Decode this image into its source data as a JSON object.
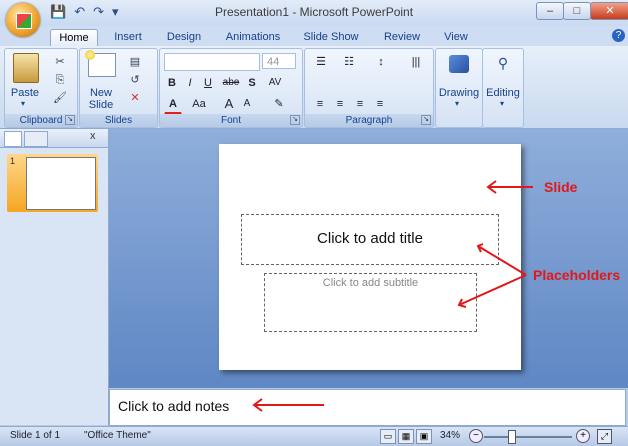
{
  "window": {
    "title": "Presentation1 - Microsoft PowerPoint",
    "minimize_label": "–",
    "maximize_label": "□",
    "close_label": "✕"
  },
  "qat": {
    "save_icon": "💾",
    "undo_icon": "↶",
    "redo_icon": "↷",
    "customize_icon": "▾"
  },
  "tabs": [
    "Home",
    "Insert",
    "Design",
    "Animations",
    "Slide Show",
    "Review",
    "View"
  ],
  "help_icon": "?",
  "ribbon": {
    "clipboard": {
      "label": "Clipboard",
      "paste": "Paste",
      "cut_icon": "✂",
      "copy_icon": "⎘",
      "painter_icon": "🖌"
    },
    "slides": {
      "label": "Slides",
      "new_slide": "New Slide",
      "layout_icon": "▤",
      "reset_icon": "↺",
      "delete_icon": "✕"
    },
    "font": {
      "label": "Font",
      "font_size": "44",
      "bold": "B",
      "italic": "I",
      "underline": "U",
      "strike": "abe",
      "shadow": "S",
      "spacing": "AV",
      "font_color": "A",
      "change_case": "Aa",
      "grow": "A",
      "shrink": "A",
      "clear": "✎"
    },
    "paragraph": {
      "label": "Paragraph",
      "bullets": "☰",
      "numbering": "☷",
      "line_spacing": "↕",
      "columns": "|||",
      "align_left": "≡",
      "align_center": "≡",
      "align_right": "≡",
      "justify": "≡"
    },
    "drawing": {
      "label": "Drawing"
    },
    "editing": {
      "label": "Editing"
    }
  },
  "slide": {
    "title_placeholder": "Click to add title",
    "subtitle_placeholder": "Click to add subtitle"
  },
  "thumbnail": {
    "number": "1"
  },
  "notes_placeholder": "Click to add notes",
  "status": {
    "slide_count": "Slide 1 of 1",
    "theme": "\"Office Theme\"",
    "zoom": "34%",
    "zoom_out": "−",
    "zoom_in": "+"
  },
  "annotations": {
    "slide": "Slide",
    "placeholders": "Placeholders"
  },
  "colors": {
    "annotation": "#e21818",
    "ribbon": "#c9d9ef",
    "accent": "#15428b"
  }
}
